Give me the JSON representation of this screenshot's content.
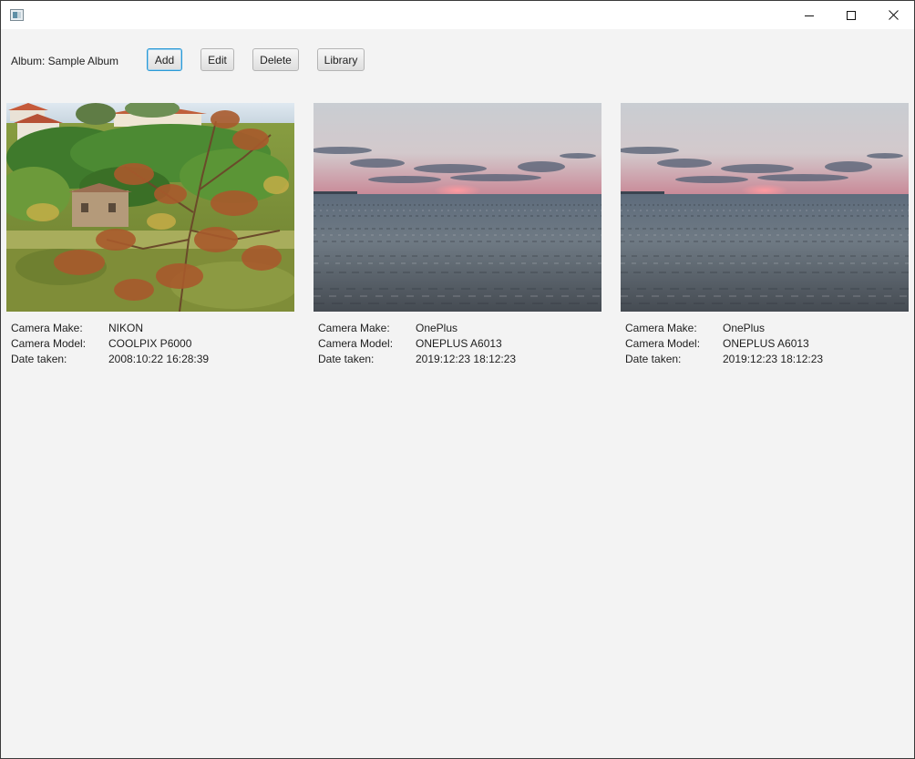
{
  "window": {
    "controls": {
      "minimize": "minimize-icon",
      "maximize": "maximize-icon",
      "close": "close-icon"
    }
  },
  "toolbar": {
    "album_label": "Album: Sample Album",
    "add_label": "Add",
    "edit_label": "Edit",
    "delete_label": "Delete",
    "library_label": "Library"
  },
  "photos": [
    {
      "scene": "village-landscape",
      "labels": {
        "make": "Camera Make:",
        "model": "Camera Model:",
        "date": "Date taken:"
      },
      "make": "NIKON",
      "model": "COOLPIX P6000",
      "date": "2008:10:22 16:28:39"
    },
    {
      "scene": "sea-sunset",
      "labels": {
        "make": "Camera Make:",
        "model": "Camera Model:",
        "date": "Date taken:"
      },
      "make": "OnePlus",
      "model": "ONEPLUS A6013",
      "date": "2019:12:23 18:12:23"
    },
    {
      "scene": "sea-sunset",
      "labels": {
        "make": "Camera Make:",
        "model": "Camera Model:",
        "date": "Date taken:"
      },
      "make": "OnePlus",
      "model": "ONEPLUS A6013",
      "date": "2019:12:23 18:12:23"
    }
  ],
  "colors": {
    "window_bg": "#f3f3f3",
    "titlebar_bg": "#ffffff",
    "focus_accent": "#2b9ad6"
  }
}
